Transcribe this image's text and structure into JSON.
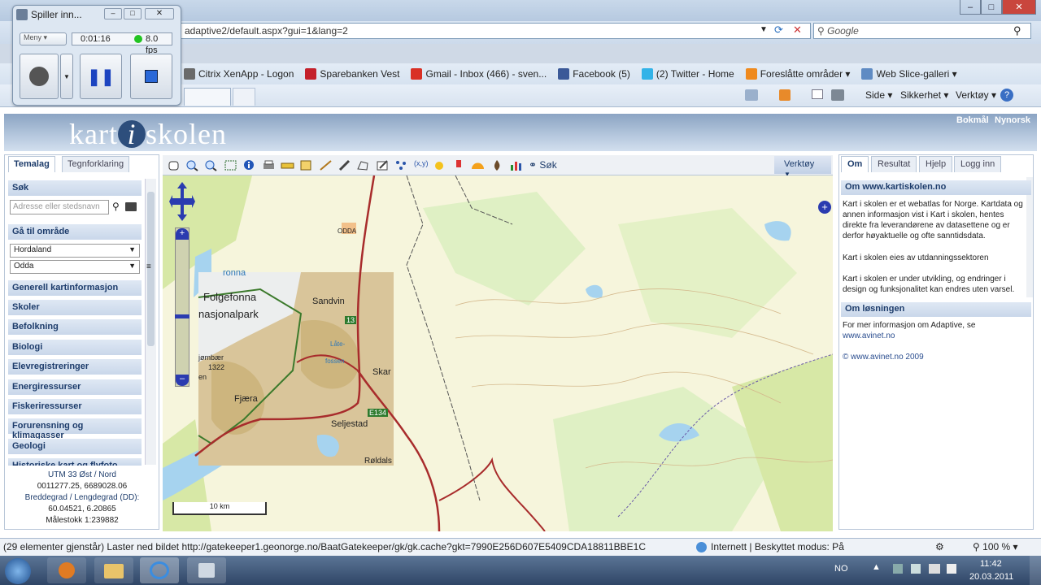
{
  "browser": {
    "url": "adaptive2/default.aspx?gui=1&lang=2",
    "search_placeholder": "Google",
    "favorites": [
      {
        "label": "Citrix XenApp - Logon",
        "color": "#6a6a6a"
      },
      {
        "label": "Sparebanken Vest",
        "color": "#c4202b"
      },
      {
        "label": "Gmail - Inbox (466) - sven...",
        "color": "#d93025"
      },
      {
        "label": "Facebook (5)",
        "color": "#3b5998"
      },
      {
        "label": "(2) Twitter - Home",
        "color": "#33b3e8"
      },
      {
        "label": "Foreslåtte områder ▾",
        "color": "#ef8a1e"
      },
      {
        "label": "Web Slice-galleri ▾",
        "color": "#5f8bc3"
      }
    ],
    "commands": {
      "page": "Side ▾",
      "security": "Sikkerhet ▾",
      "tools": "Verktøy ▾"
    }
  },
  "recorder": {
    "title": "Spiller inn...",
    "menu": "Meny",
    "time": "0:01:16",
    "fps": "8.0 fps"
  },
  "site": {
    "logo_left": "kart",
    "logo_i": "i",
    "logo_right": "skolen",
    "lang_bokmal": "Bokmål",
    "lang_nynorsk": "Nynorsk"
  },
  "left": {
    "tabs": [
      "Temalag",
      "Tegnforklaring"
    ],
    "search_header": "Søk",
    "search_placeholder": "Adresse eller stedsnavn",
    "goto_header": "Gå til område",
    "county": "Hordaland",
    "municipality": "Odda",
    "sections": [
      "Generell kartinformasjon",
      "Skoler",
      "Befolkning",
      "Biologi",
      "Elevregistreringer",
      "Energiressurser",
      "Fiskeriressurser",
      "Forurensning og klimagasser",
      "Geologi",
      "Historiske kart og flyfoto"
    ],
    "coord_title": "UTM 33 Øst / Nord",
    "coord_utm": "0011277.25, 6689028.06",
    "coord_dd_title": "Breddegrad / Lengdegrad (DD):",
    "coord_dd": "60.04521, 6.20865",
    "scale": "Målestokk 1:239882"
  },
  "map": {
    "toolbar_search": "Søk",
    "tools_button": "Verktøy",
    "scale_label": "10 km",
    "places": [
      "ODDA",
      "ronna",
      "Folgefonna",
      "nasjonalpark",
      "Sandvin",
      "13",
      "Låte-",
      "fossen",
      "Skar",
      "jømbær",
      "1322",
      "en",
      "Fjæra",
      "E134",
      "Seljestad",
      "Røldals"
    ]
  },
  "right": {
    "tabs": [
      "Om",
      "Resultat",
      "Hjelp",
      "Logg inn"
    ],
    "about_header": "Om www.kartiskolen.no",
    "about_p1": "Kart i skolen er et webatlas for Norge. Kartdata og annen informasjon vist i Kart i skolen, hentes direkte fra leverandørene av datasettene og er derfor høyaktuelle og ofte sanntidsdata.",
    "about_p2": "Kart i skolen eies av utdanningssektoren",
    "about_p3": "Kart i skolen er under utvikling, og endringer i design og funksjonalitet kan endres uten varsel.",
    "solution_header": "Om løsningen",
    "solution_text": "For mer informasjon om Adaptive, se",
    "solution_link": "www.avinet.no",
    "copyright": "© www.avinet.no 2009"
  },
  "status": {
    "text": "(29 elementer gjenstår) Laster ned bildet http://gatekeeper1.geonorge.no/BaatGatekeeper/gk/gk.cache?gkt=7990E256D607E5409CDA18811BBE1C",
    "zone": "Internett | Beskyttet modus: På",
    "zoom": "100 %"
  },
  "taskbar": {
    "lang": "NO",
    "time": "11:42",
    "date": "20.03.2011"
  },
  "colors": {
    "accent": "#1d3c6b",
    "rec_green": "#22c422",
    "map_blue": "#2233aa"
  }
}
